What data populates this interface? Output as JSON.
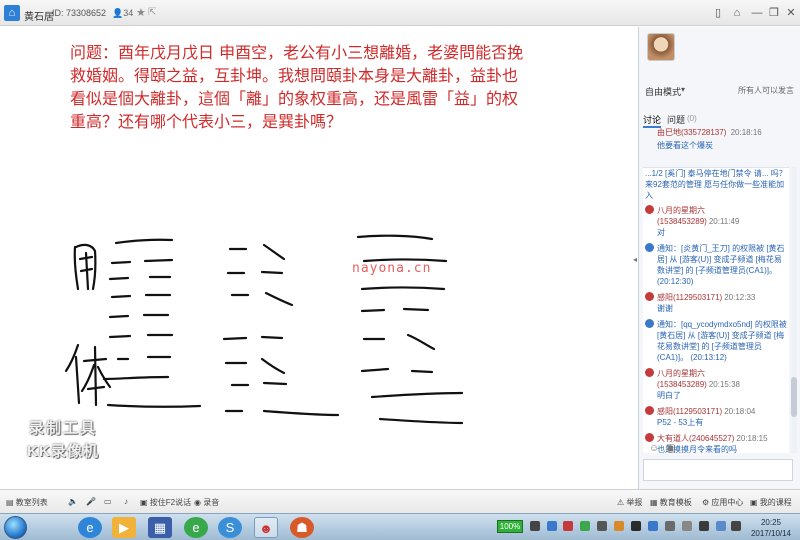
{
  "titlebar": {
    "room_name": "黄石居",
    "room_id": "ID: 73308652",
    "user_count": "34",
    "star_icon": "star-icon",
    "buttons": [
      "phone-icon",
      "pin-icon",
      "minimize-icon",
      "restore-icon",
      "close-icon"
    ]
  },
  "board": {
    "question_text": "问题：酉年戊月戊日 申酉空，老公有小三想離婚，老婆問能否挽救婚姻。得頤之益，互卦坤。我想問頤卦本身是大離卦，益卦也看似是個大離卦，這個「離」的象权重高，还是風雷「益」的权重高？还有哪个代表小三，是巽卦嗎？",
    "watermark": "nayona.cn",
    "logo_line1": "录制工具",
    "logo_line2": "KK录像机",
    "ink_color": "#111111"
  },
  "sidebar": {
    "mode_label": "自由模式",
    "mode_caret": "▾",
    "can_speak": "所有人可以发言",
    "tabs": [
      {
        "label": "讨论",
        "active": true
      },
      {
        "label": "问题",
        "active": false,
        "count": "(0)"
      }
    ],
    "pinned": {
      "name": "由巳地(335728137)",
      "time": "20:18:16",
      "message": "他要看这个爆炭"
    },
    "top_strip": "...1/2 [奚门] 泰马停在地门禁令 请...\n吗？来92套范的管理 愿与任你做一些准能加入",
    "messages": [
      {
        "name": "八月的星期六(1538453289)",
        "time": "20:11:49",
        "body": "对",
        "type": "user"
      },
      {
        "name": "",
        "time": "",
        "body": "通知：[炎黄门_王刀] 的权限被 [黄石居] 从 [游客(U)] 变成子频道 [梅花易数讲堂] 的 [子频道管理员(CA1)]。 (20:12:30)",
        "type": "system"
      },
      {
        "name": "感阳(1129503171)",
        "time": "20:12:33",
        "body": "谢谢",
        "type": "user"
      },
      {
        "name": "",
        "time": "",
        "body": "通知：[qq_ycodymdxo5nd] 的权限被 [黄石居] 从 [游客(U)] 变成子频道 [梅花易数讲堂] 的 [子频道管理员(CA1)]。 (20:13:12)",
        "type": "system"
      },
      {
        "name": "八月的星期六(1538453289)",
        "time": "20:15:38",
        "body": "明白了",
        "type": "user"
      },
      {
        "name": "感阳(1129503171)",
        "time": "20:18:04",
        "body": "P52 - 53上有",
        "type": "user"
      },
      {
        "name": "大有道人(240645527)",
        "time": "20:18:15",
        "body": "也是摸摸月令来看的吗",
        "type": "user"
      }
    ]
  },
  "toolbar": {
    "left": [
      "教室列表"
    ],
    "mic_icons": [
      "speaker-icon",
      "mic-icon",
      "record-mic-icon"
    ],
    "items": [
      "按住F2说话",
      "录音"
    ],
    "right": [
      "举报",
      "教育模板",
      "应用中心",
      "我的课程"
    ]
  },
  "taskbar": {
    "battery": "100%",
    "time": "20:25",
    "date": "2017/10/14",
    "apps": [
      "ie-icon",
      "media-icon",
      "video-icon",
      "ie-icon",
      "sogou-icon",
      "robot-icon",
      "game-icon"
    ]
  },
  "colors": {
    "question": "#cf2b2b",
    "link": "#2a64b5",
    "name": "#a33333"
  }
}
